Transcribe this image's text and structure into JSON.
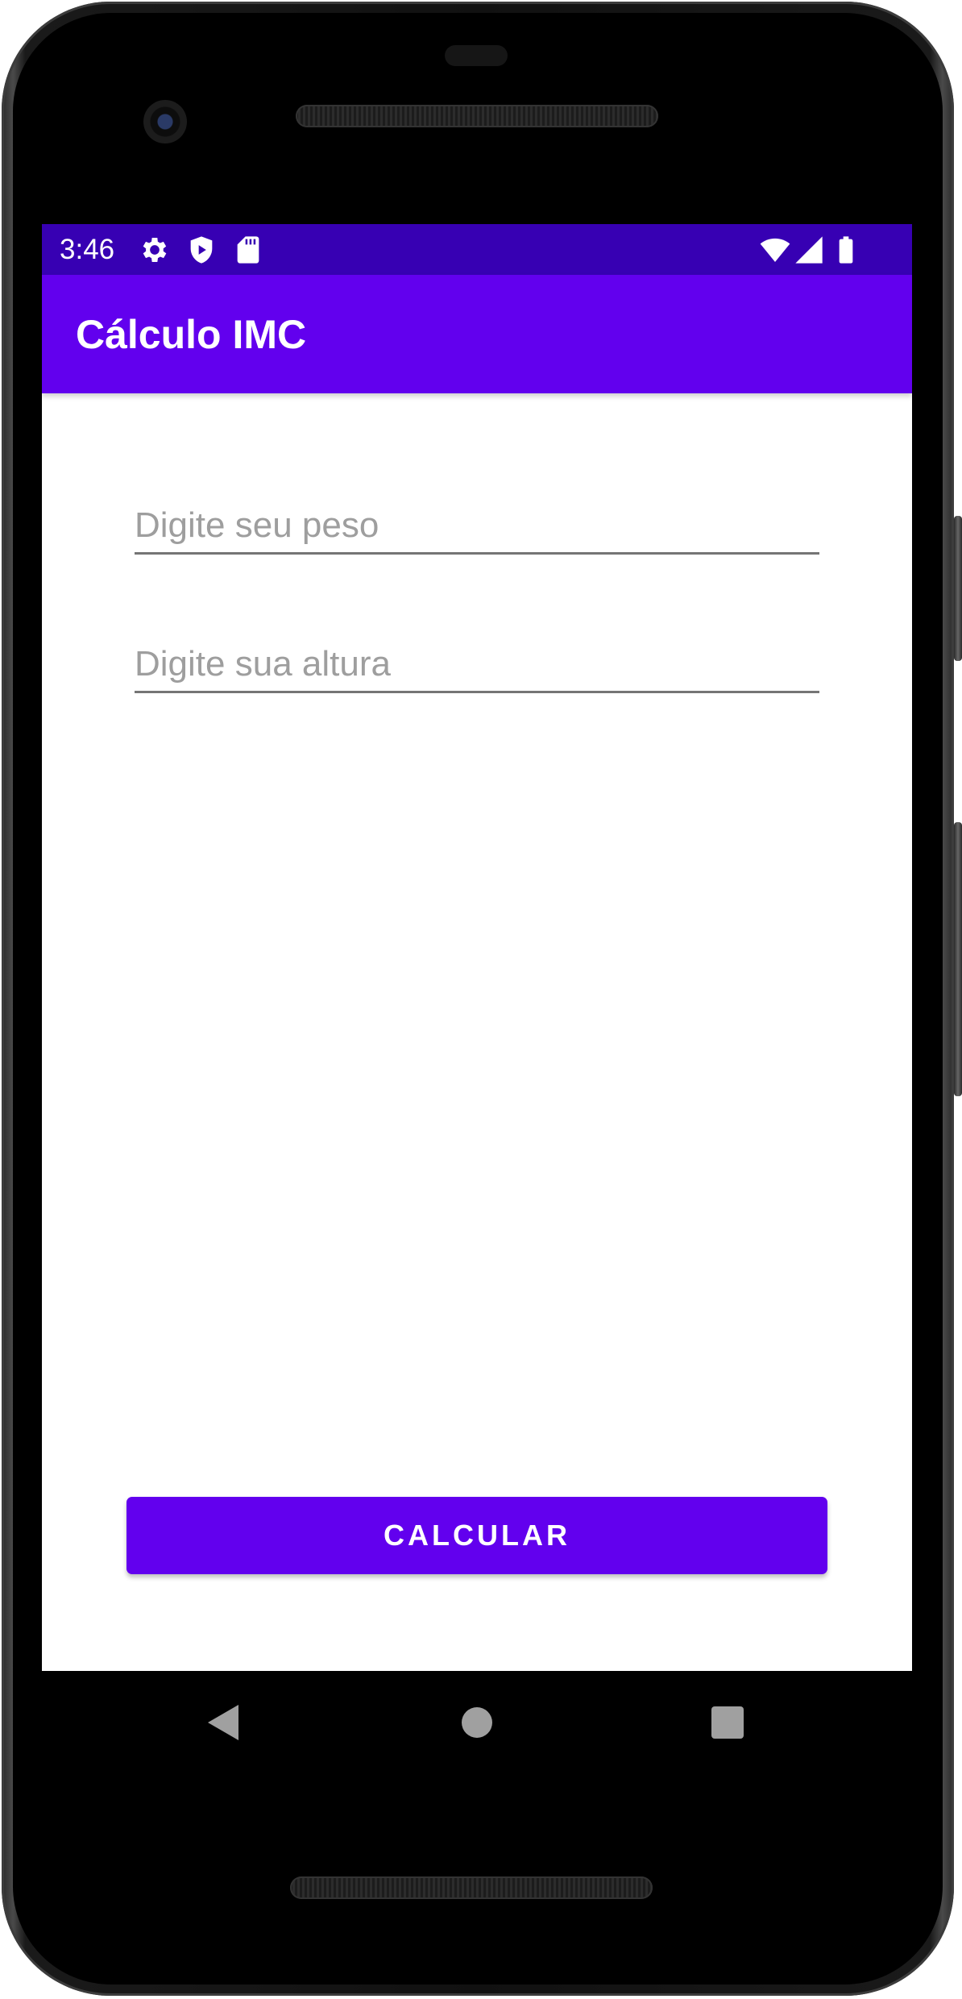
{
  "status_bar": {
    "time": "3:46",
    "left_icons": [
      "gear-icon",
      "shield-play-icon",
      "sd-card-icon"
    ],
    "right_icons": [
      "wifi-icon",
      "cell-signal-icon",
      "battery-icon"
    ]
  },
  "app_bar": {
    "title": "Cálculo IMC"
  },
  "form": {
    "weight_placeholder": "Digite seu peso",
    "weight_value": "",
    "height_placeholder": "Digite sua altura",
    "height_value": ""
  },
  "actions": {
    "calculate_label": "CALCULAR"
  },
  "nav_bar": {
    "buttons": [
      "back-icon",
      "home-icon",
      "recents-icon"
    ]
  },
  "colors": {
    "status_bar": "#3700b3",
    "primary": "#6200ee",
    "background": "#ffffff"
  }
}
